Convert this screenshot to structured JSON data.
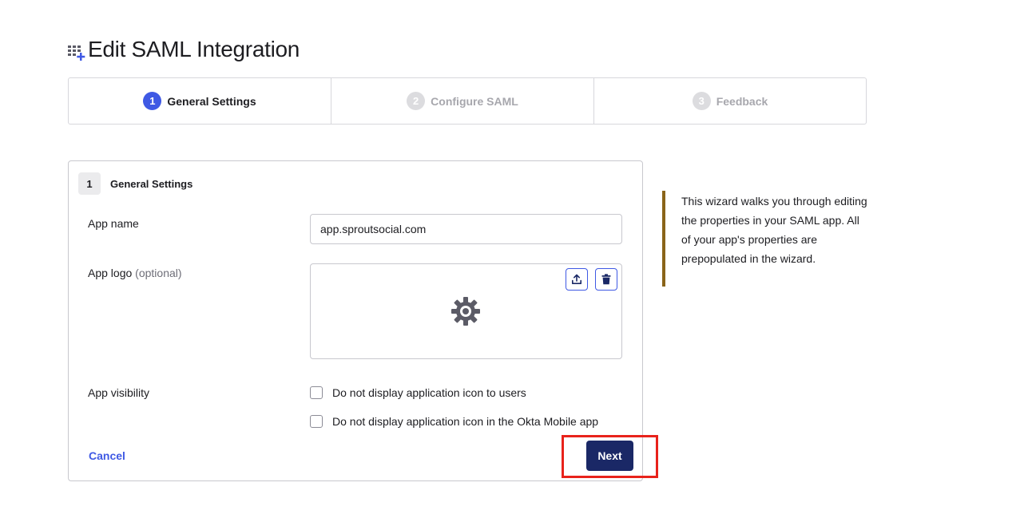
{
  "page": {
    "title": "Edit SAML Integration"
  },
  "steps": [
    {
      "number": "1",
      "label": "General Settings",
      "state": "active"
    },
    {
      "number": "2",
      "label": "Configure SAML",
      "state": "inactive"
    },
    {
      "number": "3",
      "label": "Feedback",
      "state": "inactive"
    }
  ],
  "card": {
    "number": "1",
    "title": "General Settings",
    "app_name_label": "App name",
    "app_name_value": "app.sproutsocial.com",
    "app_logo_label": "App logo",
    "app_logo_optional": "(optional)",
    "app_visibility_label": "App visibility",
    "checkbox_hide_users": "Do not display application icon to users",
    "checkbox_hide_mobile": "Do not display application icon in the Okta Mobile app",
    "cancel_label": "Cancel",
    "next_label": "Next"
  },
  "help": {
    "text": "This wizard walks you through editing the properties in your SAML app. All of your app's properties are prepopulated in the wizard."
  },
  "colors": {
    "accent": "#3f59e4",
    "primary_button": "#1a2866",
    "help_border": "#8a6419",
    "highlight": "#e8221b"
  },
  "icons": {
    "title": "apps-add-icon",
    "upload": "upload-icon",
    "delete": "trash-icon",
    "logo_placeholder": "gear-icon"
  }
}
